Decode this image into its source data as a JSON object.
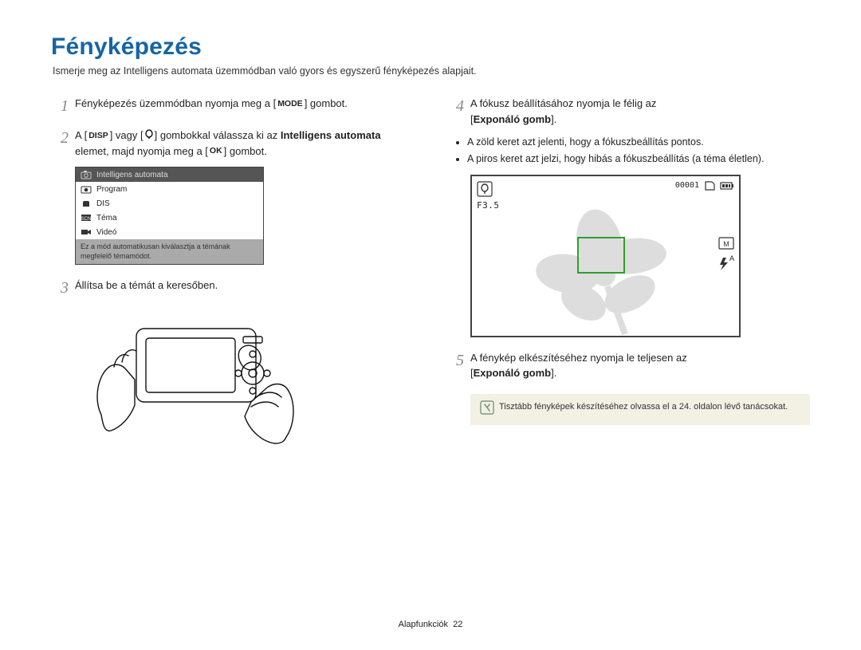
{
  "title": "Fényképezés",
  "intro": "Ismerje meg az Intelligens automata üzemmódban való gyors és egyszerű fényképezés alapjait.",
  "left": {
    "step1": {
      "before": "Fényképezés üzemmódban nyomja meg a [",
      "key": "MODE",
      "after": "] gombot."
    },
    "step2": {
      "a": "A [",
      "disp": "DISP",
      "mid": "] vagy [",
      "flowerIconAlt": "M",
      "end": "] gombokkal válassza ki az ",
      "bold": "Intelligens automata",
      "after": " elemet, majd nyomja meg a [",
      "ok": "OK",
      "tail": "] gombot."
    },
    "modes": {
      "items": [
        "Intelligens automata",
        "Program",
        "DIS",
        "Téma",
        "Videó"
      ],
      "hint": "Ez a mód automatikusan kiválasztja a témának megfelelő témamódot."
    },
    "step3": "Állítsa be a témát a keresőben."
  },
  "right": {
    "step4": {
      "text": "A fókusz beállításához nyomja le félig az",
      "bold": "Exponáló gomb",
      "tail": "."
    },
    "bullets": [
      "A zöld keret azt jelenti, hogy a fókuszbeállítás pontos.",
      "A piros keret azt jelzi, hogy hibás a fókuszbeállítás (a téma életlen)."
    ],
    "preview": {
      "counter": "00001",
      "fval": "F3.5",
      "flashAuto": "A"
    },
    "step5": {
      "text": "A fénykép elkészítéséhez nyomja le teljesen az",
      "bold": "Exponáló gomb",
      "tail": "."
    },
    "note": "Tisztább fényképek készítéséhez olvassa el a 24. oldalon lévő tanácsokat."
  },
  "footer": {
    "label": "Alapfunkciók",
    "page": "22"
  }
}
